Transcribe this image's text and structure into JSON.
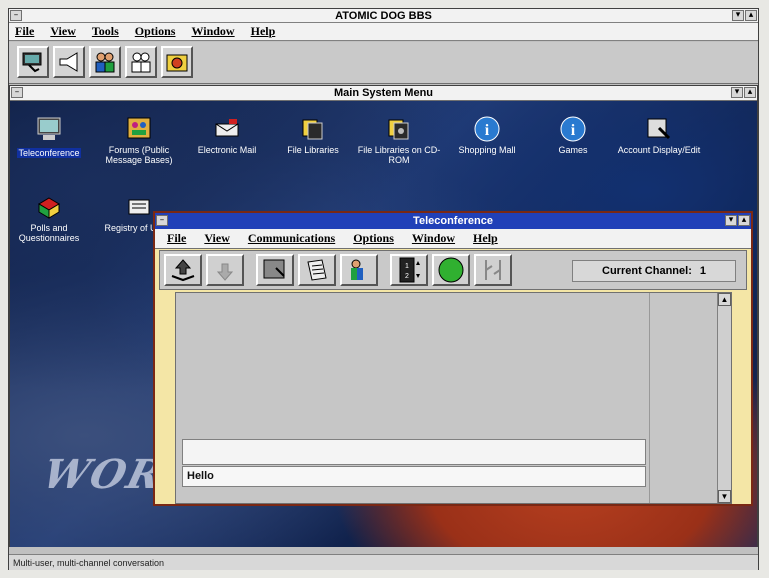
{
  "app": {
    "title": "ATOMIC DOG BBS"
  },
  "menu": [
    "File",
    "View",
    "Tools",
    "Options",
    "Window",
    "Help"
  ],
  "toolbar": [
    "teleconference-tool-icon",
    "megaphone-icon",
    "users-icon",
    "people-icon",
    "message-folder-icon"
  ],
  "main_menu": {
    "title": "Main System Menu",
    "icons": [
      {
        "label": "Teleconference",
        "icon": "monitor-icon",
        "selected": true
      },
      {
        "label": "Forums (Public Message Bases)",
        "icon": "forum-icon"
      },
      {
        "label": "Electronic Mail",
        "icon": "mail-icon"
      },
      {
        "label": "File Libraries",
        "icon": "file-library-icon"
      },
      {
        "label": "File Libraries on CD-ROM",
        "icon": "cdrom-library-icon"
      },
      {
        "label": "Shopping Mall",
        "icon": "info-icon"
      },
      {
        "label": "Games",
        "icon": "info-icon"
      },
      {
        "label": "Account Display/Edit",
        "icon": "account-edit-icon"
      },
      {
        "label": "Polls and Questionnaires",
        "icon": "poll-icon"
      },
      {
        "label": "Registry of Users",
        "icon": "registry-icon"
      }
    ]
  },
  "tele": {
    "title": "Teleconference",
    "menu": [
      "File",
      "View",
      "Communications",
      "Options",
      "Window",
      "Help"
    ],
    "channel_label": "Current Channel:",
    "channel_value": "1",
    "input_text": "Hello"
  },
  "status": "Multi-user, multi-channel conversation",
  "colors": {
    "title_active": "#2040b8",
    "window_frame": "#f4e6a6",
    "border": "#7a2814"
  }
}
